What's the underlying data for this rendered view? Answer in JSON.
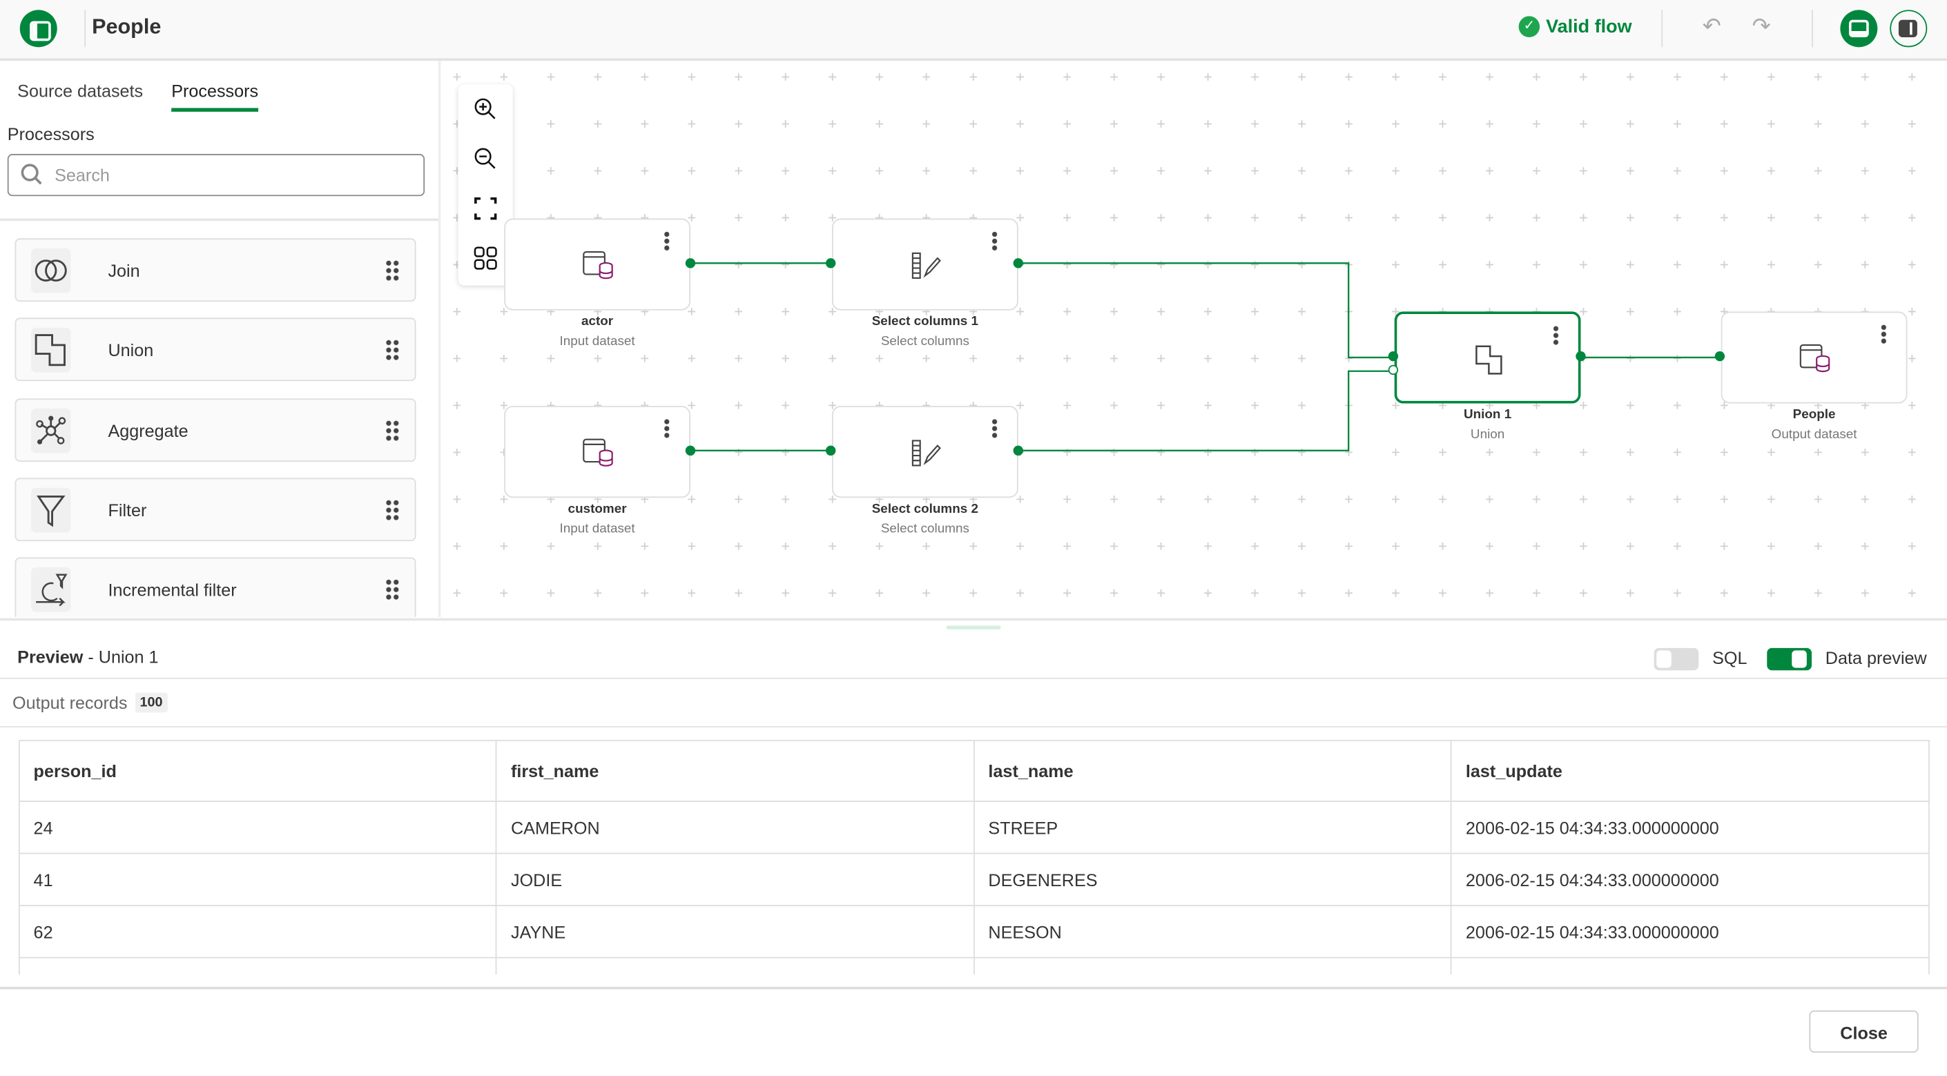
{
  "header": {
    "title": "People",
    "status": "Valid flow",
    "undo_icon": "undo-icon",
    "redo_icon": "redo-icon"
  },
  "colors": {
    "accent": "#00873d",
    "dataset_icon": "#8a1a6e"
  },
  "sidebar": {
    "tabs": [
      {
        "label": "Source datasets"
      },
      {
        "label": "Processors",
        "active": true
      }
    ],
    "section_title": "Processors",
    "search_placeholder": "Search",
    "items": [
      {
        "label": "Join",
        "icon": "join-icon"
      },
      {
        "label": "Union",
        "icon": "union-icon"
      },
      {
        "label": "Aggregate",
        "icon": "aggregate-icon"
      },
      {
        "label": "Filter",
        "icon": "filter-icon"
      },
      {
        "label": "Incremental filter",
        "icon": "incremental-filter-icon"
      }
    ]
  },
  "flow": {
    "nodes": [
      {
        "name": "actor",
        "type": "Input dataset"
      },
      {
        "name": "Select columns 1",
        "type": "Select columns"
      },
      {
        "name": "customer",
        "type": "Input dataset"
      },
      {
        "name": "Select columns 2",
        "type": "Select columns"
      },
      {
        "name": "Union 1",
        "type": "Union",
        "selected": true
      },
      {
        "name": "People",
        "type": "Output dataset"
      }
    ]
  },
  "preview": {
    "title": "Preview",
    "subtitle": " - Union 1",
    "sql_label": "SQL",
    "sql_on": false,
    "data_preview_label": "Data preview",
    "data_preview_on": true,
    "output_records_label": "Output records",
    "output_records_count": "100",
    "columns": [
      "person_id",
      "first_name",
      "last_name",
      "last_update"
    ],
    "rows": [
      [
        "24",
        "CAMERON",
        "STREEP",
        "2006-02-15 04:34:33.000000000"
      ],
      [
        "41",
        "JODIE",
        "DEGENERES",
        "2006-02-15 04:34:33.000000000"
      ],
      [
        "62",
        "JAYNE",
        "NEESON",
        "2006-02-15 04:34:33.000000000"
      ]
    ]
  },
  "footer": {
    "close_label": "Close"
  }
}
